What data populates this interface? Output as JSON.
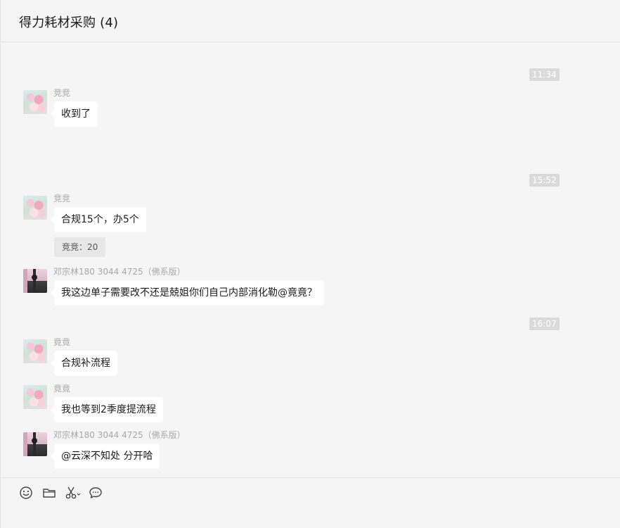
{
  "header": {
    "title": "得力耗材采购 (4)"
  },
  "messages": [
    {
      "type": "time",
      "text": "11:34"
    },
    {
      "type": "msg",
      "sender": "竞竞",
      "avatar": "flower-avatar",
      "text": "收到了"
    },
    {
      "type": "time",
      "text": "15:52"
    },
    {
      "type": "msg",
      "sender": "竞竞",
      "avatar": "flower-avatar",
      "text": "合规15个，办5个",
      "quote": "竞竞：20"
    },
    {
      "type": "msg",
      "sender": "邓宗林180 3044 4725（佛系版）",
      "avatar": "photo-avatar",
      "text": "我这边单子需要改不还是兢姐你们自己内部消化勒@竟竟？"
    },
    {
      "type": "time",
      "text": "16:07"
    },
    {
      "type": "msg",
      "sender": "竟竟",
      "avatar": "flower-avatar",
      "text": "合规补流程"
    },
    {
      "type": "msg",
      "sender": "竟竟",
      "avatar": "flower-avatar",
      "text": "我也等到2季度提流程"
    },
    {
      "type": "msg",
      "sender": "邓宗林180 3044 4725（佛系版）",
      "avatar": "photo-avatar",
      "text": "@云深不知处 分开哈"
    }
  ],
  "toolbar": {
    "icons": [
      "emoji-icon",
      "folder-icon",
      "scissors-icon",
      "chat-bubble-icon"
    ]
  }
}
